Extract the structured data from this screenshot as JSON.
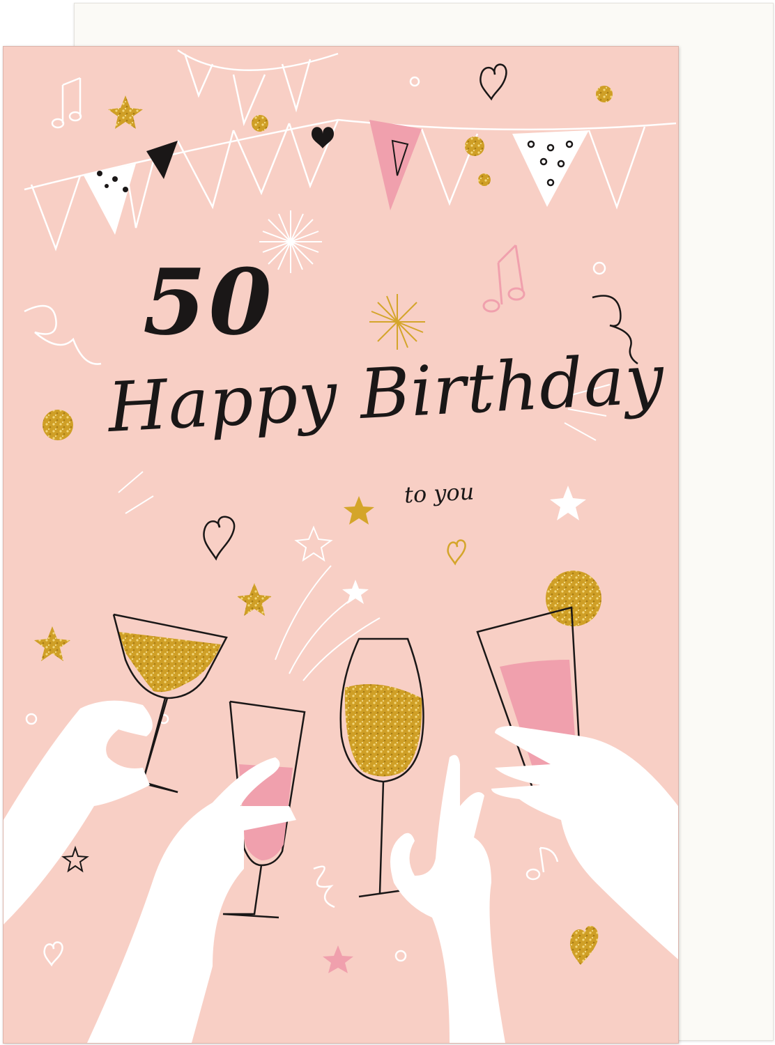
{
  "card": {
    "age": "50",
    "title": "Happy Birthday",
    "subtitle": "to you"
  },
  "colors": {
    "card_background": "#f8cfc5",
    "envelope": "#fbfaf6",
    "gold": "#d4a52a",
    "pink": "#f0a0ad",
    "ink": "#1a1717",
    "white": "#ffffff"
  },
  "icons": [
    "bunting-banner",
    "music-note-icon",
    "heart-icon",
    "star-icon",
    "firework-burst",
    "gold-glitter-dot",
    "cocktail-glass",
    "champagne-flute",
    "wine-glass",
    "highball-glass",
    "raised-hand"
  ]
}
